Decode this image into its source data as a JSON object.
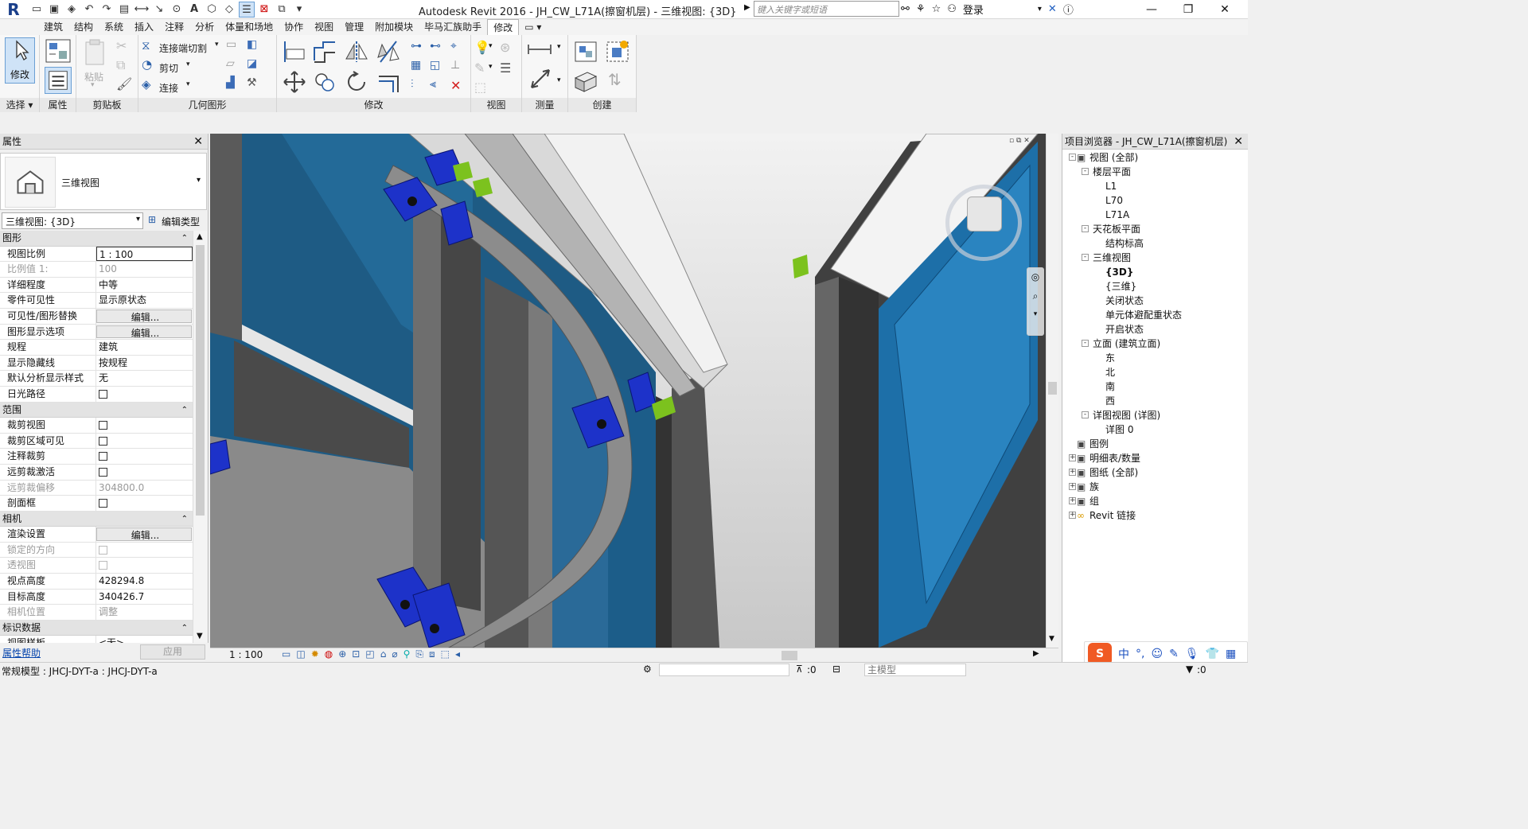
{
  "app": {
    "title": "Autodesk Revit 2016 -     JH_CW_L71A(擦窗机层) - 三维视图: {3D}",
    "search_placeholder": "键入关键字或短语",
    "login_label": "登录",
    "logo": "R"
  },
  "ribbon": {
    "tabs": [
      "建筑",
      "结构",
      "系统",
      "插入",
      "注释",
      "分析",
      "体量和场地",
      "协作",
      "视图",
      "管理",
      "附加模块",
      "毕马汇族助手",
      "修改"
    ],
    "active_tab": "修改",
    "modify_label": "修改",
    "paste_label": "粘贴",
    "cope_label": "连接端切割",
    "cut_label": "剪切",
    "join_label": "连接",
    "panels": {
      "select": "选择",
      "properties": "属性",
      "clipboard": "剪贴板",
      "geometry": "几何图形",
      "modify": "修改",
      "view": "视图",
      "measure": "测量",
      "create": "创建"
    }
  },
  "properties": {
    "header": "属性",
    "type_name": "三维视图",
    "instance_selector": "三维视图: {3D}",
    "edit_type_label": "编辑类型",
    "groups": [
      {
        "name": "图形",
        "rows": [
          {
            "k": "视图比例",
            "v": "1 : 100",
            "style": "boxed"
          },
          {
            "k": "比例值 1:",
            "v": "100",
            "disabled": true
          },
          {
            "k": "详细程度",
            "v": "中等"
          },
          {
            "k": "零件可见性",
            "v": "显示原状态"
          },
          {
            "k": "可见性/图形替换",
            "v": "编辑...",
            "style": "btn"
          },
          {
            "k": "图形显示选项",
            "v": "编辑...",
            "style": "btn"
          },
          {
            "k": "规程",
            "v": "建筑"
          },
          {
            "k": "显示隐藏线",
            "v": "按规程"
          },
          {
            "k": "默认分析显示样式",
            "v": "无"
          },
          {
            "k": "日光路径",
            "v": "",
            "check": true
          }
        ]
      },
      {
        "name": "范围",
        "rows": [
          {
            "k": "裁剪视图",
            "v": "",
            "check": true
          },
          {
            "k": "裁剪区域可见",
            "v": "",
            "check": true
          },
          {
            "k": "注释裁剪",
            "v": "",
            "check": true
          },
          {
            "k": "远剪裁激活",
            "v": "",
            "check": true
          },
          {
            "k": "远剪裁偏移",
            "v": "304800.0",
            "disabled": true
          },
          {
            "k": "剖面框",
            "v": "",
            "check": true
          }
        ]
      },
      {
        "name": "相机",
        "rows": [
          {
            "k": "渲染设置",
            "v": "编辑...",
            "style": "btn"
          },
          {
            "k": "锁定的方向",
            "v": "",
            "check": true,
            "disabled": true
          },
          {
            "k": "透视图",
            "v": "",
            "check": true,
            "disabled": true
          },
          {
            "k": "视点高度",
            "v": "428294.8"
          },
          {
            "k": "目标高度",
            "v": "340426.7"
          },
          {
            "k": "相机位置",
            "v": "调整",
            "disabled": true
          }
        ]
      },
      {
        "name": "标识数据",
        "rows": [
          {
            "k": "视图样板",
            "v": "<无>"
          }
        ]
      }
    ],
    "help_link": "属性帮助",
    "apply_label": "应用"
  },
  "viewbar": {
    "scale": "1 : 100"
  },
  "browser": {
    "header": "项目浏览器 - JH_CW_L71A(擦窗机层)",
    "tree": [
      {
        "label": "视图 (全部)",
        "level": 0,
        "exp": "-",
        "icon": "views-icon"
      },
      {
        "label": "楼层平面",
        "level": 1,
        "exp": "-"
      },
      {
        "label": "L1",
        "level": 2
      },
      {
        "label": "L70",
        "level": 2
      },
      {
        "label": "L71A",
        "level": 2
      },
      {
        "label": "天花板平面",
        "level": 1,
        "exp": "-"
      },
      {
        "label": "结构标高",
        "level": 2
      },
      {
        "label": "三维视图",
        "level": 1,
        "exp": "-"
      },
      {
        "label": "{3D}",
        "level": 2,
        "bold": true
      },
      {
        "label": "{三维}",
        "level": 2
      },
      {
        "label": "关闭状态",
        "level": 2
      },
      {
        "label": "单元体避配重状态",
        "level": 2
      },
      {
        "label": "开启状态",
        "level": 2
      },
      {
        "label": "立面 (建筑立面)",
        "level": 1,
        "exp": "-"
      },
      {
        "label": "东",
        "level": 2
      },
      {
        "label": "北",
        "level": 2
      },
      {
        "label": "南",
        "level": 2
      },
      {
        "label": "西",
        "level": 2
      },
      {
        "label": "详图视图 (详图)",
        "level": 1,
        "exp": "-"
      },
      {
        "label": "详图 0",
        "level": 2
      },
      {
        "label": "图例",
        "level": 0,
        "icon": "legend-icon"
      },
      {
        "label": "明细表/数量",
        "level": 0,
        "exp": "+",
        "icon": "schedule-icon"
      },
      {
        "label": "图纸 (全部)",
        "level": 0,
        "exp": "+",
        "icon": "sheet-icon"
      },
      {
        "label": "族",
        "level": 0,
        "exp": "+",
        "icon": "family-icon"
      },
      {
        "label": "组",
        "level": 0,
        "exp": "+",
        "icon": "group-icon"
      },
      {
        "label": "Revit 链接",
        "level": 0,
        "exp": "+",
        "icon": "link-icon"
      }
    ]
  },
  "status": {
    "text": "常规模型 : JHCJ-DYT-a : JHCJ-DYT-a",
    "selection_count": ":0",
    "model_label": "主模型",
    "filter_count": ":0"
  },
  "ime": {
    "lang": "中"
  }
}
